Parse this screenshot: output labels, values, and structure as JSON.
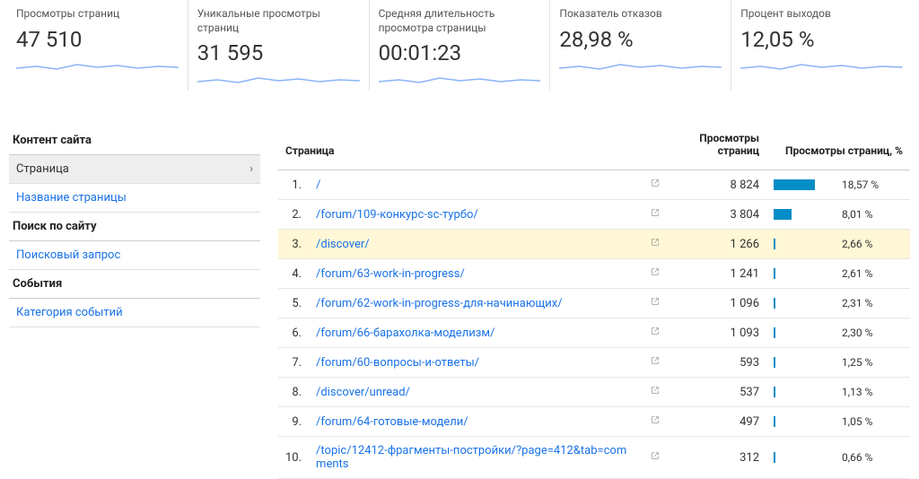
{
  "metrics": [
    {
      "label": "Просмотры страниц",
      "value": "47 510"
    },
    {
      "label": "Уникальные просмотры страниц",
      "value": "31 595"
    },
    {
      "label": "Средняя длительность просмотра страницы",
      "value": "00:01:23"
    },
    {
      "label": "Показатель отказов",
      "value": "28,98 %"
    },
    {
      "label": "Процент выходов",
      "value": "12,05 %"
    }
  ],
  "sidebar": {
    "content_title": "Контент сайта",
    "items_content": [
      {
        "label": "Страница",
        "active": true
      },
      {
        "label": "Название страницы",
        "active": false
      }
    ],
    "search_title": "Поиск по сайту",
    "items_search": [
      {
        "label": "Поисковый запрос",
        "active": false
      }
    ],
    "events_title": "События",
    "items_events": [
      {
        "label": "Категория событий",
        "active": false
      }
    ]
  },
  "table": {
    "headers": {
      "page": "Страница",
      "views": "Просмотры страниц",
      "pct": "Просмотры страниц, %"
    },
    "rows": [
      {
        "idx": "1.",
        "page": "/",
        "views": "8 824",
        "pct": "18,57 %",
        "bar": 65,
        "hl": false
      },
      {
        "idx": "2.",
        "page": "/forum/109-конкурс-sc-турбо/",
        "views": "3 804",
        "pct": "8,01 %",
        "bar": 28,
        "hl": false
      },
      {
        "idx": "3.",
        "page": "/discover/",
        "views": "1 266",
        "pct": "2,66 %",
        "bar": 0,
        "hl": true
      },
      {
        "idx": "4.",
        "page": "/forum/63-work-in-progress/",
        "views": "1 241",
        "pct": "2,61 %",
        "bar": 0,
        "hl": false
      },
      {
        "idx": "5.",
        "page": "/forum/62-work-in-progress-для-начинающих/",
        "views": "1 096",
        "pct": "2,31 %",
        "bar": 0,
        "hl": false
      },
      {
        "idx": "6.",
        "page": "/forum/66-барахолка-моделизм/",
        "views": "1 093",
        "pct": "2,30 %",
        "bar": 0,
        "hl": false
      },
      {
        "idx": "7.",
        "page": "/forum/60-вопросы-и-ответы/",
        "views": "593",
        "pct": "1,25 %",
        "bar": 0,
        "hl": false
      },
      {
        "idx": "8.",
        "page": "/discover/unread/",
        "views": "537",
        "pct": "1,13 %",
        "bar": 0,
        "hl": false
      },
      {
        "idx": "9.",
        "page": "/forum/64-готовые-модели/",
        "views": "497",
        "pct": "1,05 %",
        "bar": 0,
        "hl": false
      },
      {
        "idx": "10.",
        "page": "/topic/12412-фрагменты-постройки/?page=412&tab=comments",
        "views": "312",
        "pct": "0,66 %",
        "bar": 0,
        "hl": false
      }
    ]
  }
}
